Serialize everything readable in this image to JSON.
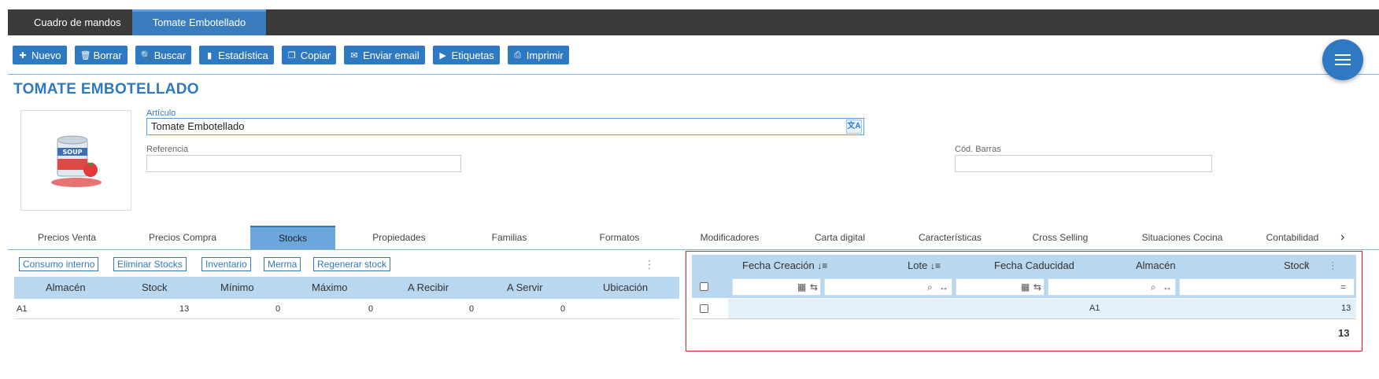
{
  "top_tabs": [
    {
      "label": "Cuadro de mandos"
    },
    {
      "label": "Tomate Embotellado"
    }
  ],
  "toolbar": {
    "buttons": [
      {
        "label": "Nuevo",
        "icon": "plus-icon"
      },
      {
        "label": "Borrar",
        "icon": "trash-icon"
      },
      {
        "label": "Buscar",
        "icon": "search-icon"
      },
      {
        "label": "Estadística",
        "icon": "chart-icon"
      },
      {
        "label": "Copiar",
        "icon": "copy-icon"
      },
      {
        "label": "Enviar email",
        "icon": "mail-icon"
      },
      {
        "label": "Etiquetas",
        "icon": "tag-icon"
      },
      {
        "label": "Imprimir",
        "icon": "print-icon"
      }
    ]
  },
  "page": {
    "title": "TOMATE EMBOTELLADO"
  },
  "form": {
    "articulo_label": "Artículo",
    "articulo_value": "Tomate Embotellado",
    "referencia_label": "Referencia",
    "referencia_value": "",
    "cod_barras_label": "Cód. Barras",
    "cod_barras_value": ""
  },
  "tabs": [
    {
      "label": "Precios Venta"
    },
    {
      "label": "Precios Compra"
    },
    {
      "label": "Stocks"
    },
    {
      "label": "Propiedades"
    },
    {
      "label": "Familias"
    },
    {
      "label": "Formatos"
    },
    {
      "label": "Modificadores"
    },
    {
      "label": "Carta digital"
    },
    {
      "label": "Características"
    },
    {
      "label": "Cross Selling"
    },
    {
      "label": "Situaciones Cocina"
    },
    {
      "label": "Contabilidad"
    }
  ],
  "stock_actions": [
    {
      "label": "Consumo interno"
    },
    {
      "label": "Eliminar Stocks"
    },
    {
      "label": "Inventario"
    },
    {
      "label": "Merma"
    },
    {
      "label": "Regenerar stock"
    }
  ],
  "left_table": {
    "headers": [
      "Almacén",
      "Stock",
      "Mínimo",
      "Máximo",
      "A Recibir",
      "A Servir",
      "Ubicación"
    ],
    "rows": [
      [
        "A1",
        "13",
        "0",
        "0",
        "0",
        "0",
        ""
      ]
    ]
  },
  "right_table": {
    "headers": [
      "Fecha Creación",
      "Lote",
      "Fecha Caducidad",
      "Almacén",
      "Stock"
    ],
    "filter_eq": "=",
    "rows": [
      [
        "",
        "",
        "",
        "A1",
        "13"
      ]
    ],
    "total": "13"
  },
  "colors": {
    "accent": "#2f79c2",
    "topbar": "#3b3b3b",
    "header_bg": "#b9d7ef",
    "highlight_border": "#dd2222"
  }
}
